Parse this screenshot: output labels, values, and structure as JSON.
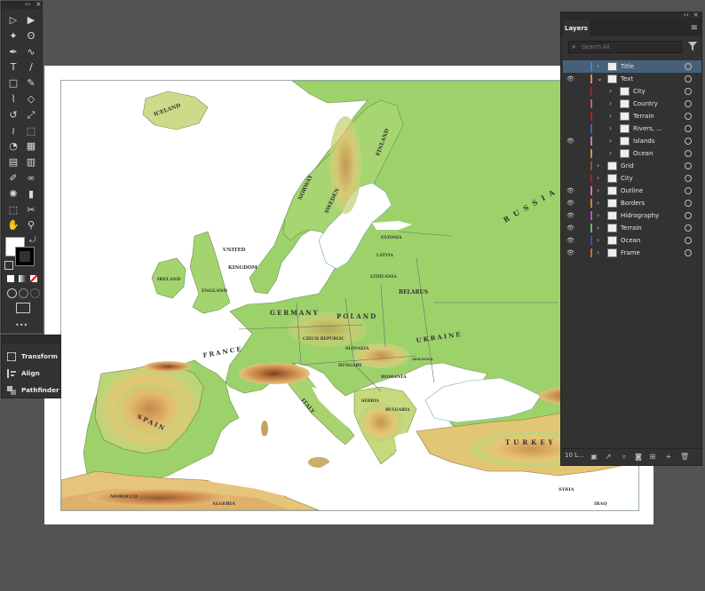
{
  "toolbar": {
    "tools": [
      "selection-tool",
      "direct-selection-tool",
      "magic-wand-tool",
      "lasso-tool",
      "pen-tool",
      "curvature-tool",
      "type-tool",
      "line-segment-tool",
      "rectangle-tool",
      "paintbrush-tool",
      "shaper-tool",
      "eraser-tool",
      "rotate-tool",
      "scale-tool",
      "warp-tool",
      "free-transform-tool",
      "shape-builder-tool",
      "perspective-grid-tool",
      "mesh-tool",
      "gradient-tool",
      "eyedropper-tool",
      "blend-tool",
      "symbol-sprayer-tool",
      "column-graph-tool",
      "artboard-tool",
      "slice-tool",
      "hand-tool",
      "zoom-tool"
    ],
    "more": "•••"
  },
  "mini_panel": {
    "items": [
      {
        "label": "Transform",
        "icon": "transform-icon"
      },
      {
        "label": "Align",
        "icon": "align-icon"
      },
      {
        "label": "Pathfinder",
        "icon": "pathfinder-icon"
      }
    ]
  },
  "map": {
    "labels": {
      "iceland": "ICELAND",
      "uk1": "UNITED",
      "uk2": "KINGDOM",
      "ireland": "IRELAND",
      "england": "ENGLAND",
      "norway": "NORWAY",
      "sweden": "SWEDEN",
      "finland": "FINLAND",
      "estonia": "ESTONIA",
      "latvia": "LATVIA",
      "lithuania": "LITHUANIA",
      "belarus": "BELARUS",
      "germany": "GERMANY",
      "poland": "POLAND",
      "ukraine": "UKRAINE",
      "russia": "RUSSIA",
      "france": "FRANCE",
      "spain": "SPAIN",
      "italy": "ITALY",
      "czech": "CZECH REPUBLIC",
      "slovakia": "SLOVAKIA",
      "hungary": "HUNGARY",
      "romania": "ROMANIA",
      "serbia": "SERBIA",
      "bulgaria": "BULGARIA",
      "moldova": "MOLDOVA",
      "turkey": "TURKEY",
      "morocco": "MOROCCO",
      "algeria": "ALGERIA",
      "syria": "SYRIA",
      "iraq": "IRAQ"
    },
    "colors": {
      "lowland": "#8ccf66",
      "hill": "#d8dc8a",
      "plateau": "#efc878",
      "mountain": "#d08a4e",
      "peak": "#8b4a2a",
      "sea": "#ffffff"
    }
  },
  "layers_panel": {
    "tab": "Layers",
    "search_placeholder": "Search All",
    "count": "10 L...",
    "rows": [
      {
        "name": "Title",
        "color": "#4b7bd8",
        "selected": true,
        "visible": false,
        "expanded": false,
        "indent": 0
      },
      {
        "name": "Text",
        "color": "#e08a3c",
        "selected": false,
        "visible": true,
        "expanded": true,
        "indent": 0
      },
      {
        "name": "City",
        "color": "#b0143a",
        "selected": false,
        "visible": false,
        "expanded": false,
        "indent": 1
      },
      {
        "name": "Country",
        "color": "#e04a6a",
        "selected": false,
        "visible": false,
        "expanded": false,
        "indent": 1
      },
      {
        "name": "Terrain",
        "color": "#c01818",
        "selected": false,
        "visible": false,
        "expanded": false,
        "indent": 1
      },
      {
        "name": "Rivers, ...",
        "color": "#3a66c8",
        "selected": false,
        "visible": false,
        "expanded": false,
        "indent": 1
      },
      {
        "name": "Islands",
        "color": "#e06ab0",
        "selected": false,
        "visible": true,
        "expanded": false,
        "indent": 1
      },
      {
        "name": "Ocean",
        "color": "#e08a3c",
        "selected": false,
        "visible": false,
        "expanded": false,
        "indent": 1
      },
      {
        "name": "Grid",
        "color": "#8a5a2a",
        "selected": false,
        "visible": false,
        "expanded": false,
        "indent": 0
      },
      {
        "name": "City",
        "color": "#b0143a",
        "selected": false,
        "visible": false,
        "expanded": false,
        "indent": 0
      },
      {
        "name": "Outline",
        "color": "#d86ad0",
        "selected": false,
        "visible": true,
        "expanded": false,
        "indent": 0
      },
      {
        "name": "Borders",
        "color": "#e0782a",
        "selected": false,
        "visible": true,
        "expanded": false,
        "indent": 0
      },
      {
        "name": "Hidrography",
        "color": "#c04ad8",
        "selected": false,
        "visible": true,
        "expanded": false,
        "indent": 0
      },
      {
        "name": "Terrain",
        "color": "#4ac85a",
        "selected": false,
        "visible": true,
        "expanded": false,
        "indent": 0
      },
      {
        "name": "Ocean",
        "color": "#3a4ad8",
        "selected": false,
        "visible": true,
        "expanded": false,
        "indent": 0
      },
      {
        "name": "Frame",
        "color": "#e05a3a",
        "selected": false,
        "visible": true,
        "expanded": false,
        "indent": 0
      }
    ]
  }
}
